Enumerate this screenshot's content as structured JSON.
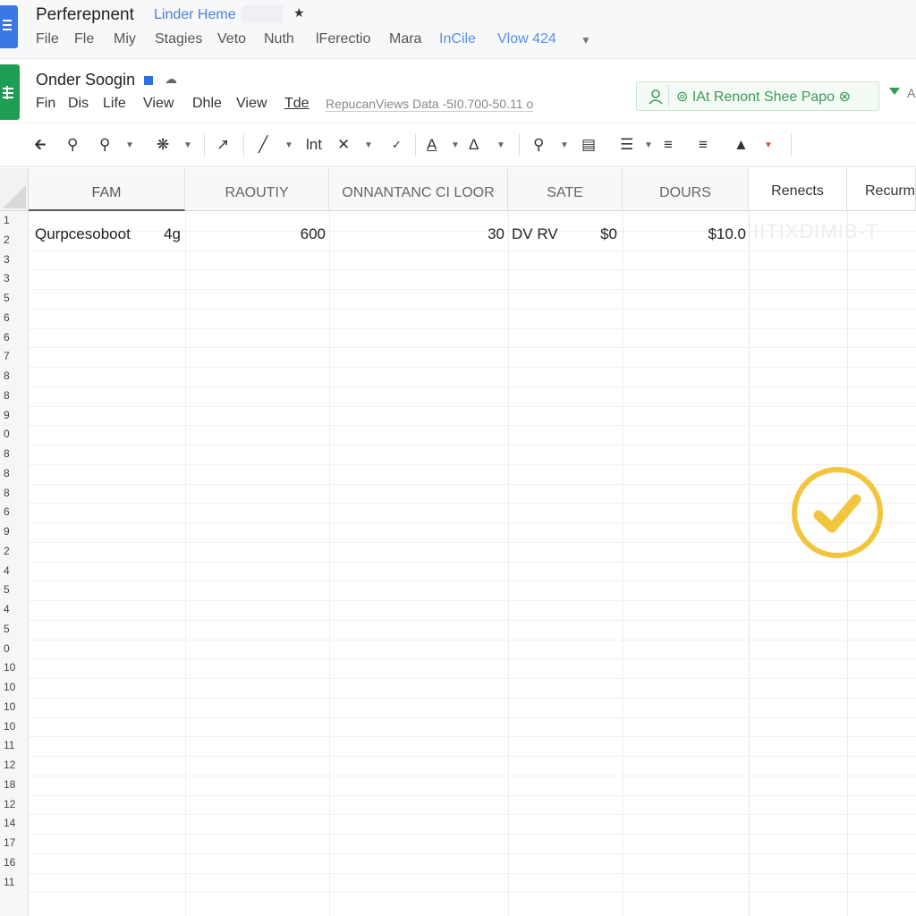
{
  "app1": {
    "title": "Perferepnent",
    "subtitle": "Linder Heme",
    "pin_icon": "pin-icon",
    "menu": [
      "File",
      "Fle",
      "Miy",
      "Stagies",
      "Veto",
      "Nuth",
      "lFerectio",
      "Mara",
      "InCile",
      "Vlow 424"
    ]
  },
  "app2": {
    "title": "Onder Soogin",
    "menu": [
      "Fin",
      "Dis",
      "Life",
      "View",
      "Dhle",
      "View",
      "Tde"
    ],
    "note": "RepucanViews Data  -5I0.700-50.11   o",
    "share_label": "⊚ IAt Renont Shee Papo ⊗",
    "extra": "A"
  },
  "toolbar": {
    "items": [
      "back-icon",
      "zoom-icon",
      "search-icon",
      "gear-icon",
      "arrow-icon",
      "pen-icon",
      "int-label",
      "close-icon",
      "check-small-icon",
      "text-color-icon",
      "font-icon",
      "find-icon",
      "image-icon",
      "align-icon",
      "list-icon",
      "lines-icon",
      "fill-icon"
    ],
    "int_label": "lnt"
  },
  "grid": {
    "columns": [
      "FAM",
      "RAOUTIY",
      "ONNANTANC CI LOOR",
      "SATE",
      "DOURS",
      "Renects",
      "Recurm"
    ],
    "row_numbers": [
      "1",
      "2",
      "3",
      "3",
      "5",
      "6",
      "6",
      "7",
      "8",
      "8",
      "9",
      "0",
      "8",
      "8",
      "8",
      "6",
      "9",
      "2",
      "4",
      "5",
      "4",
      "5",
      "0",
      "10",
      "10",
      "10",
      "10",
      "11",
      "12",
      "18",
      "12",
      "14",
      "17",
      "16",
      "11"
    ],
    "row2": {
      "a": "Qurpcesoboot",
      "a_extra": "4g",
      "b": "600",
      "c": "30",
      "d1": "DV RV",
      "d2": "$0",
      "e": "$10.0",
      "ghost": "IITIXDIMIB-T"
    }
  },
  "colors": {
    "blue_app": "#3b78e7",
    "green_app": "#1e9e55",
    "accent_green": "#3f9a58",
    "check_yellow": "#f2c53d"
  },
  "status_icon": "check-circle-icon"
}
